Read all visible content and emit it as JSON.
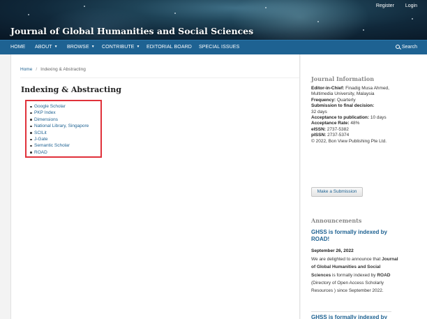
{
  "header": {
    "site_title": "Journal of Global Humanities and Social Sciences",
    "user_nav": {
      "register": "Register",
      "login": "Login"
    }
  },
  "nav": {
    "items": [
      {
        "label": "HOME",
        "dropdown": false
      },
      {
        "label": "ABOUT",
        "dropdown": true
      },
      {
        "label": "BROWSE",
        "dropdown": true
      },
      {
        "label": "CONTRIBUTE",
        "dropdown": true
      },
      {
        "label": "EDITORIAL BOARD",
        "dropdown": false
      },
      {
        "label": "SPECIAL ISSUES",
        "dropdown": false
      }
    ],
    "search_label": "Search",
    "caret": "▼"
  },
  "breadcrumb": {
    "home": "Home",
    "separator": "/",
    "current": "Indexing & Abstracting"
  },
  "page": {
    "title": "Indexing & Abstracting",
    "index_list": [
      "Google Scholar",
      "PKP Index",
      "Dimensions",
      "National Library, Singapore",
      "SCILit",
      "J-Gate",
      "Semantic Scholar",
      "ROAD"
    ],
    "highlight_color": "#e0313a"
  },
  "sidebar": {
    "journal_info_heading": "Journal Information",
    "info": {
      "editor_label": "Editor-in-Chief:",
      "editor_value": "Finadig Musa Ahmed, Multimedia University, Malaysia",
      "frequency_label": "Frequency:",
      "frequency_value": "Quarterly",
      "submission_label": "Submission to final decision:",
      "submission_value": "32 days",
      "acceptance_label": "Acceptance to publication:",
      "acceptance_value": "10 days",
      "rate_label": "Acceptance Rate:",
      "rate_value": "48%",
      "eissn_label": "eISSN:",
      "eissn_value": "2737-5382",
      "pissn_label": "pISSN:",
      "pissn_value": "2737-5374",
      "copyright": "© 2022, Bon View Publishing Pte Ltd."
    },
    "submit_button": "Make a Submission",
    "announcements_heading": "Announcements",
    "announcement": {
      "title": "GHSS is formally indexed by ROAD!",
      "date": "September 26, 2022",
      "body_1": "We are delighted to announce that ",
      "body_journal": "Journal of Global Humanities and Social Sciences",
      "body_2": " is formally indexed by ",
      "body_road": "ROAD",
      "body_3": " (Directory of Open Access Scholarly Resources ) since September 2022."
    },
    "next_announcement": "GHSS is formally indexed by"
  },
  "colors": {
    "nav_bg": "#1e6292",
    "link": "#1e6292",
    "page_bg": "#f3f3f3"
  }
}
